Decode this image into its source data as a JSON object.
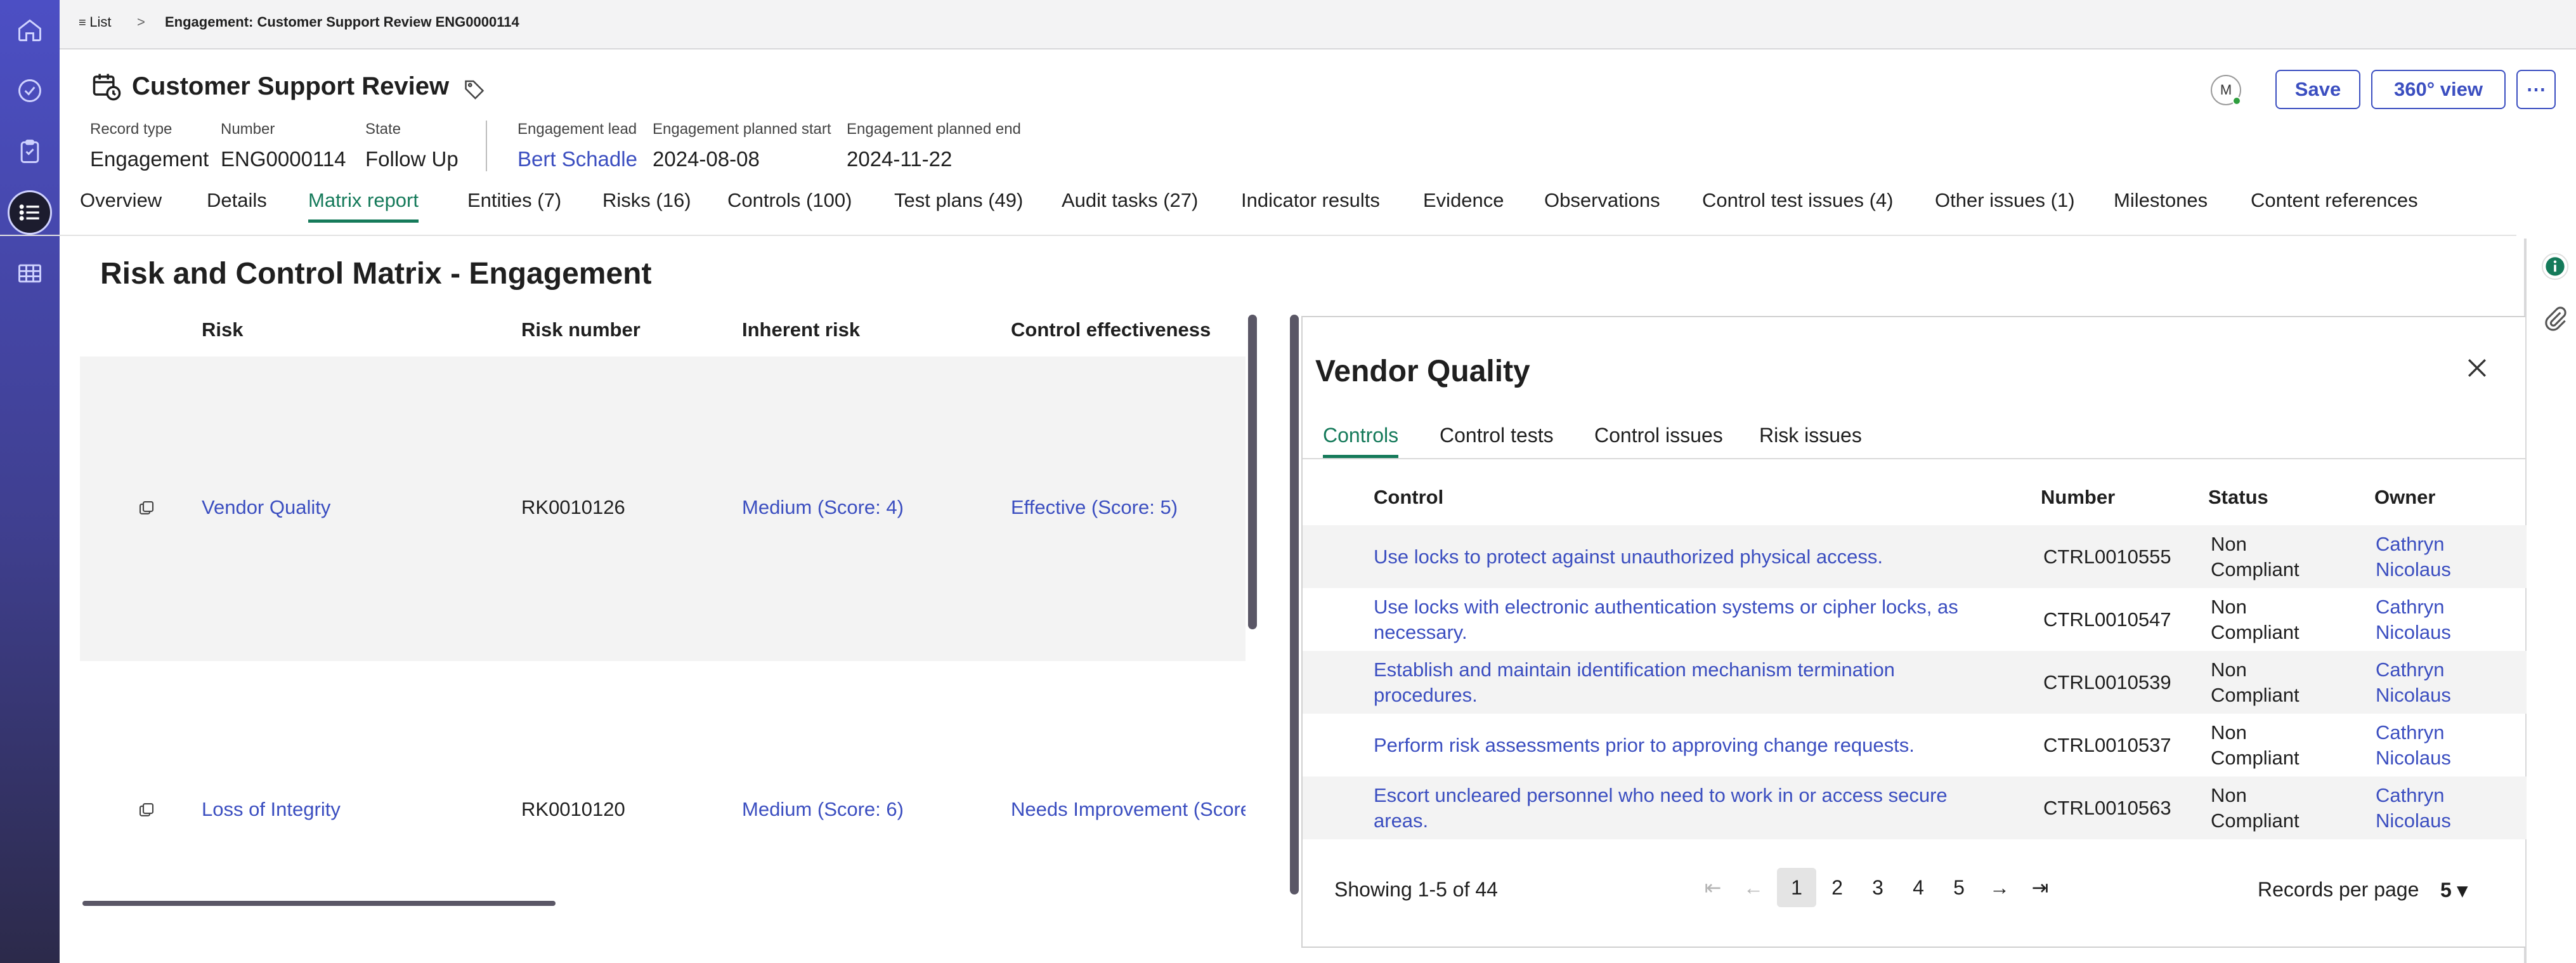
{
  "breadcrumb": {
    "list_label": "List",
    "separator": ">",
    "current": "Engagement: Customer Support Review ENG0000114"
  },
  "record": {
    "title": "Customer Support Review",
    "fields": [
      {
        "label": "Record type",
        "value": "Engagement"
      },
      {
        "label": "Number",
        "value": "ENG0000114"
      },
      {
        "label": "State",
        "value": "Follow Up"
      },
      {
        "label": "Engagement lead",
        "value": "Bert Schadle"
      },
      {
        "label": "Engagement planned start",
        "value": "2024-08-08"
      },
      {
        "label": "Engagement planned end",
        "value": "2024-11-22"
      }
    ]
  },
  "actions": {
    "avatar_initial": "M",
    "save_label": "Save",
    "view360_label": "360° view",
    "more_label": "⋯"
  },
  "tabs": [
    "Overview",
    "Details",
    "Matrix report",
    "Entities (7)",
    "Risks (16)",
    "Controls (100)",
    "Test plans (49)",
    "Audit tasks (27)",
    "Indicator results",
    "Evidence",
    "Observations",
    "Control test issues (4)",
    "Other issues (1)",
    "Milestones",
    "Content references"
  ],
  "active_tab": "Matrix report",
  "matrix": {
    "title": "Risk and Control Matrix - Engagement",
    "columns": [
      "Risk",
      "Risk number",
      "Inherent risk",
      "Control effectiveness"
    ],
    "rows": [
      {
        "risk": "Vendor Quality",
        "number": "RK0010126",
        "inherent": "Medium (Score: 4)",
        "effectiveness": "Effective (Score: 5)"
      },
      {
        "risk": "Loss of Integrity",
        "number": "RK0010120",
        "inherent": "Medium (Score: 6)",
        "effectiveness": "Needs Improvement (Score"
      }
    ]
  },
  "panel": {
    "title": "Vendor Quality",
    "tabs": [
      "Controls",
      "Control tests",
      "Control issues",
      "Risk issues"
    ],
    "columns": [
      "Control",
      "Number",
      "Status",
      "Owner"
    ],
    "rows": [
      {
        "control": "Use locks to protect against unauthorized physical access.",
        "number": "CTRL0010555",
        "status": "Non Compliant",
        "owner": "Cathryn Nicolaus"
      },
      {
        "control": "Use locks with electronic authentication systems or cipher locks, as necessary.",
        "number": "CTRL0010547",
        "status": "Non Compliant",
        "owner": "Cathryn Nicolaus"
      },
      {
        "control": "Establish and maintain identification mechanism termination procedures.",
        "number": "CTRL0010539",
        "status": "Non Compliant",
        "owner": "Cathryn Nicolaus"
      },
      {
        "control": "Perform risk assessments prior to approving change requests.",
        "number": "CTRL0010537",
        "status": "Non Compliant",
        "owner": "Cathryn Nicolaus"
      },
      {
        "control": "Escort uncleared personnel who need to work in or access secure areas.",
        "number": "CTRL0010563",
        "status": "Non Compliant",
        "owner": "Cathryn Nicolaus"
      }
    ],
    "pagination": {
      "showing": "Showing 1-5 of 44",
      "pages": [
        "1",
        "2",
        "3",
        "4",
        "5"
      ],
      "current_page": "1",
      "records_label": "Records per page",
      "records_value": "5"
    }
  },
  "colors": {
    "accent": "#3b4ec0",
    "active_tab": "#157a5a",
    "rail": "#4c4fc4"
  },
  "icons": [
    "home-icon",
    "check-circle-icon",
    "clipboard-icon",
    "list-icon",
    "table-icon",
    "calendar-clock-icon",
    "tag-icon",
    "close-icon",
    "info-icon",
    "paperclip-icon",
    "expand-icon"
  ]
}
